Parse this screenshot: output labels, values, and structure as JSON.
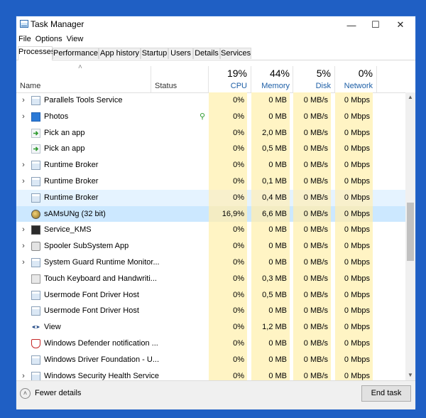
{
  "window": {
    "title": "Task Manager",
    "minimize_glyph": "—",
    "maximize_glyph": "☐",
    "close_glyph": "✕"
  },
  "menu": [
    "File",
    "Options",
    "View"
  ],
  "tabs": [
    "Processes",
    "Performance",
    "App history",
    "Startup",
    "Users",
    "Details",
    "Services"
  ],
  "columns": {
    "name": "Name",
    "status": "Status",
    "cpu": {
      "pct": "19%",
      "label": "CPU"
    },
    "memory": {
      "pct": "44%",
      "label": "Memory"
    },
    "disk": {
      "pct": "5%",
      "label": "Disk"
    },
    "network": {
      "pct": "0%",
      "label": "Network"
    }
  },
  "processes": [
    {
      "expand": "›",
      "icon": "service-icon",
      "name": "Parallels Tools Service",
      "status": "",
      "cpu": "0%",
      "memory": "0 MB",
      "disk": "0 MB/s",
      "network": "0 Mbps"
    },
    {
      "expand": "›",
      "icon": "photos-icon",
      "name": "Photos",
      "status": "",
      "cpu": "0%",
      "memory": "0 MB",
      "disk": "0 MB/s",
      "network": "0 Mbps"
    },
    {
      "expand": "",
      "icon": "pick-app-icon",
      "name": "Pick an app",
      "status": "",
      "cpu": "0%",
      "memory": "2,0 MB",
      "disk": "0 MB/s",
      "network": "0 Mbps"
    },
    {
      "expand": "",
      "icon": "pick-app-icon",
      "name": "Pick an app",
      "status": "",
      "cpu": "0%",
      "memory": "0,5 MB",
      "disk": "0 MB/s",
      "network": "0 Mbps"
    },
    {
      "expand": "›",
      "icon": "service-icon",
      "name": "Runtime Broker",
      "status": "",
      "cpu": "0%",
      "memory": "0 MB",
      "disk": "0 MB/s",
      "network": "0 Mbps"
    },
    {
      "expand": "›",
      "icon": "service-icon",
      "name": "Runtime Broker",
      "status": "",
      "cpu": "0%",
      "memory": "0,1 MB",
      "disk": "0 MB/s",
      "network": "0 Mbps"
    },
    {
      "expand": "",
      "icon": "service-icon",
      "name": "Runtime Broker",
      "status": "",
      "cpu": "0%",
      "memory": "0,4 MB",
      "disk": "0 MB/s",
      "network": "0 Mbps"
    },
    {
      "expand": "",
      "icon": "samsung-app-icon",
      "name": "sAMsUNg (32 bit)",
      "status": "",
      "cpu": "16,9%",
      "memory": "6,6 MB",
      "disk": "0 MB/s",
      "network": "0 Mbps"
    },
    {
      "expand": "›",
      "icon": "console-icon",
      "name": "Service_KMS",
      "status": "",
      "cpu": "0%",
      "memory": "0 MB",
      "disk": "0 MB/s",
      "network": "0 Mbps"
    },
    {
      "expand": "›",
      "icon": "printer-icon",
      "name": "Spooler SubSystem App",
      "status": "",
      "cpu": "0%",
      "memory": "0 MB",
      "disk": "0 MB/s",
      "network": "0 Mbps"
    },
    {
      "expand": "›",
      "icon": "service-icon",
      "name": "System Guard Runtime Monitor...",
      "status": "",
      "cpu": "0%",
      "memory": "0 MB",
      "disk": "0 MB/s",
      "network": "0 Mbps"
    },
    {
      "expand": "",
      "icon": "keyboard-icon",
      "name": "Touch Keyboard and Handwriti...",
      "status": "",
      "cpu": "0%",
      "memory": "0,3 MB",
      "disk": "0 MB/s",
      "network": "0 Mbps"
    },
    {
      "expand": "",
      "icon": "service-icon",
      "name": "Usermode Font Driver Host",
      "status": "",
      "cpu": "0%",
      "memory": "0,5 MB",
      "disk": "0 MB/s",
      "network": "0 Mbps"
    },
    {
      "expand": "",
      "icon": "service-icon",
      "name": "Usermode Font Driver Host",
      "status": "",
      "cpu": "0%",
      "memory": "0 MB",
      "disk": "0 MB/s",
      "network": "0 Mbps"
    },
    {
      "expand": "",
      "icon": "view-icon",
      "name": "View",
      "status": "",
      "cpu": "0%",
      "memory": "1,2 MB",
      "disk": "0 MB/s",
      "network": "0 Mbps"
    },
    {
      "expand": "",
      "icon": "defender-icon",
      "name": "Windows Defender notification ...",
      "status": "",
      "cpu": "0%",
      "memory": "0 MB",
      "disk": "0 MB/s",
      "network": "0 Mbps"
    },
    {
      "expand": "",
      "icon": "service-icon",
      "name": "Windows Driver Foundation - U...",
      "status": "",
      "cpu": "0%",
      "memory": "0 MB",
      "disk": "0 MB/s",
      "network": "0 Mbps"
    },
    {
      "expand": "›",
      "icon": "service-icon",
      "name": "Windows Security Health Service",
      "status": "",
      "cpu": "0%",
      "memory": "0 MB",
      "disk": "0 MB/s",
      "network": "0 Mbps"
    }
  ],
  "row_states": {
    "hover_index": 6,
    "selected_index": 7
  },
  "footer": {
    "fewer_details": "Fewer details",
    "end_task": "End task"
  },
  "colors": {
    "heat": "#fff4c4",
    "selected": "#cce8ff",
    "hover": "#e5f3ff",
    "frame": "#1f5fc4"
  }
}
